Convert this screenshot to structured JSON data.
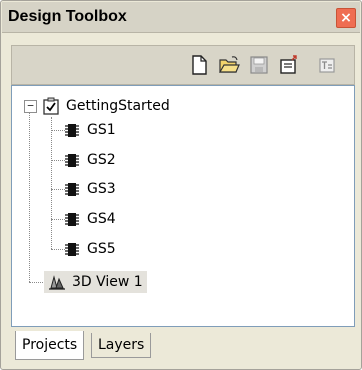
{
  "window": {
    "title": "Design Toolbox",
    "close_glyph": "×"
  },
  "toolbar": {
    "buttons": [
      {
        "icon": "new-document-icon"
      },
      {
        "icon": "open-folder-icon"
      },
      {
        "icon": "save-disk-icon"
      },
      {
        "icon": "export-icon"
      },
      {
        "icon": "text-edit-icon"
      }
    ]
  },
  "tree": {
    "root": {
      "label": "GettingStarted",
      "expander": "−",
      "checked": true
    },
    "children": [
      {
        "label": "GS1"
      },
      {
        "label": "GS2"
      },
      {
        "label": "GS3"
      },
      {
        "label": "GS4"
      },
      {
        "label": "GS5"
      }
    ],
    "view": {
      "label": "3D View 1"
    }
  },
  "tabs": [
    {
      "label": "Projects",
      "active": true
    },
    {
      "label": "Layers",
      "active": false
    }
  ],
  "colors": {
    "close_button": "#ef6d52",
    "panel": "#ece9d8",
    "tree_border": "#7f9db9"
  }
}
